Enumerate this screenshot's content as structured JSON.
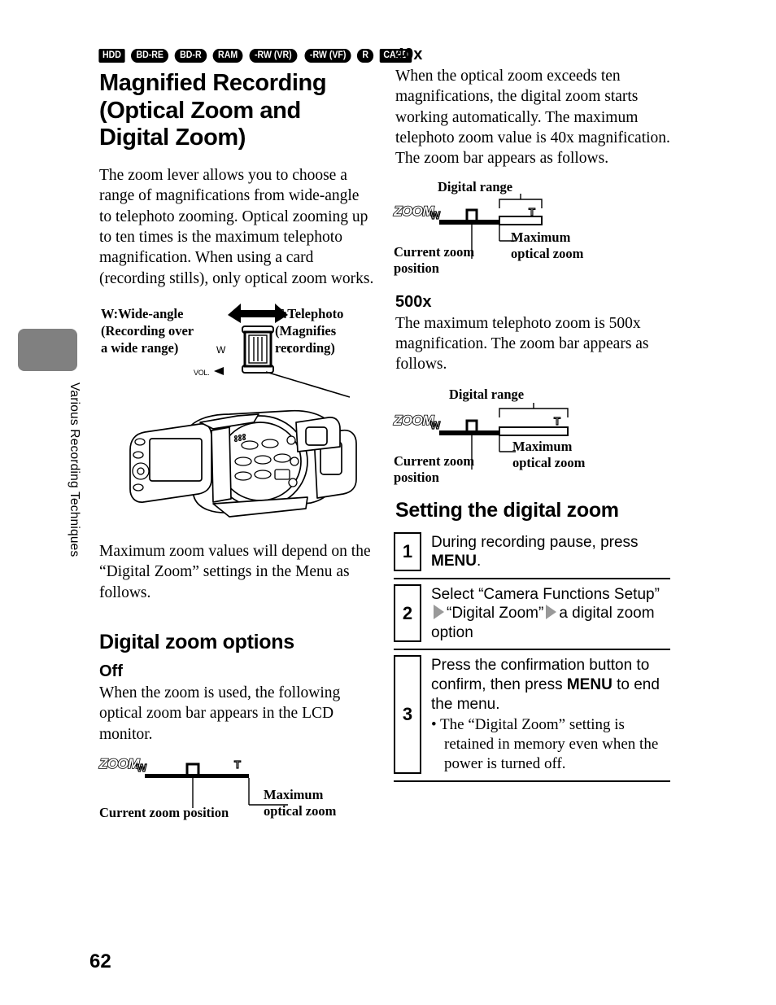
{
  "sidebar": {
    "chapter_label": "Various Recording Techniques"
  },
  "page": {
    "number": "62"
  },
  "badges": [
    {
      "label": "HDD",
      "shape": "rect"
    },
    {
      "label": "BD-RE",
      "shape": "pill"
    },
    {
      "label": "BD-R",
      "shape": "pill"
    },
    {
      "label": "RAM",
      "shape": "pill"
    },
    {
      "label": "-RW (VR)",
      "shape": "pill"
    },
    {
      "label": "-RW (VF)",
      "shape": "pill"
    },
    {
      "label": "R",
      "shape": "pill"
    },
    {
      "label": "CARD",
      "shape": "rect"
    }
  ],
  "left_column": {
    "title": "Magnified Recording (Optical Zoom and Digital Zoom)",
    "intro": "The zoom lever allows you to choose a range of magnifications from wide-angle to telephoto zooming. Optical zooming up to ten times is the maximum telephoto magnification. When using a card (recording stills), only optical zoom works.",
    "lever_diagram": {
      "wide_title": "W:Wide-angle",
      "wide_sub_line1": "(Recording over",
      "wide_sub_line2": "a wide range)",
      "tele_title": "T:Telephoto",
      "tele_sub_line1": "(Magnifies",
      "tele_sub_line2": "recording)",
      "lever_w": "W",
      "lever_t": "T",
      "vol_label": "VOL."
    },
    "after_figure": "Maximum zoom values will depend on the “Digital Zoom” settings in the Menu as follows.",
    "options_heading": "Digital zoom options",
    "off": {
      "heading": "Off",
      "body": "When the zoom is used, the following optical zoom bar appears in the LCD monitor.",
      "bar": {
        "logo": "ZOOM",
        "w": "W",
        "t": "T",
        "current_label_line1": "Current zoom position",
        "max_label_line1": "Maximum",
        "max_label_line2": "optical zoom",
        "has_digital_range": false
      }
    }
  },
  "right_column": {
    "x40": {
      "heading": "40x",
      "body": "When the optical zoom exceeds ten magnifications, the digital zoom starts working automatically. The maximum telephoto zoom value is 40x magnification. The zoom bar appears as follows.",
      "bar": {
        "logo": "ZOOM",
        "w": "W",
        "t": "T",
        "digital_range_label": "Digital range",
        "current_label_line1": "Current zoom",
        "current_label_line2": "position",
        "max_label_line1": "Maximum",
        "max_label_line2": "optical zoom",
        "has_digital_range": true
      }
    },
    "x500": {
      "heading": "500x",
      "body": "The maximum telephoto zoom is 500x magnification. The zoom bar appears as follows.",
      "bar": {
        "logo": "ZOOM",
        "w": "W",
        "t": "T",
        "digital_range_label": "Digital range",
        "current_label_line1": "Current zoom",
        "current_label_line2": "position",
        "max_label_line1": "Maximum",
        "max_label_line2": "optical zoom",
        "has_digital_range": true
      }
    },
    "setting_heading": "Setting the digital zoom",
    "steps": [
      {
        "number": "1",
        "text_before": "During recording pause, press ",
        "bold": "MENU",
        "text_after": "."
      },
      {
        "number": "2",
        "seg1": "Select “Camera Functions Setup”",
        "seg2": "“Digital Zoom”",
        "seg3": "a digital zoom option"
      },
      {
        "number": "3",
        "text_before": "Press the confirmation button to confirm, then press ",
        "bold": "MENU",
        "text_after": " to end the menu.",
        "note": "• The “Digital Zoom” setting is retained in memory even when the power is turned off."
      }
    ]
  },
  "colors": {
    "tab_gray": "#808080",
    "arrow_gray": "#999999",
    "ink": "#000000",
    "paper": "#ffffff"
  }
}
